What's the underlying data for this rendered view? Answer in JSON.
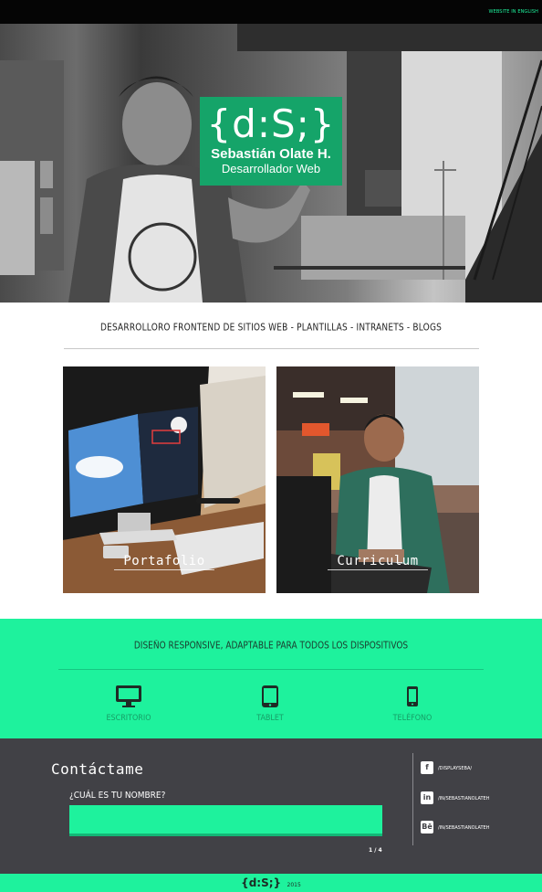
{
  "header": {
    "language_link": "WEBSITE IN ENGLISH"
  },
  "hero": {
    "logo_mark": "{d:S;}",
    "name": "Sebastián Olate H.",
    "role": "Desarrollador Web"
  },
  "intro": {
    "tagline": "DESARROLLORO FRONTEND DE SITIOS WEB - PLANTILLAS - INTRANETS - BLOGS"
  },
  "cards": [
    {
      "label": "Portafolio"
    },
    {
      "label": "Curriculum"
    }
  ],
  "responsive": {
    "title": "DISEÑO RESPONSIVE, ADAPTABLE PARA TODOS LOS DISPOSITIVOS",
    "devices": [
      {
        "label": "ESCRITORIO",
        "icon": "desktop-icon"
      },
      {
        "label": "TABLET",
        "icon": "tablet-icon"
      },
      {
        "label": "TELÉFONO",
        "icon": "phone-icon"
      }
    ]
  },
  "contact": {
    "title": "Contáctame",
    "question": "¿CUÁL ES TU NOMBRE?",
    "name_value": "",
    "step": "1 / 4"
  },
  "social": [
    {
      "icon": "facebook-icon",
      "glyph": "f",
      "handle": "/DISPLAYSEBA/"
    },
    {
      "icon": "linkedin-icon",
      "glyph": "in",
      "handle": "/IN/SEBASTIANOLATEH"
    },
    {
      "icon": "behance-icon",
      "glyph": "Bē",
      "handle": "/IN/SEBASTIANOLATEH"
    }
  ],
  "footer": {
    "logo": "{d:S;}",
    "year": "2015"
  },
  "colors": {
    "accent": "#1ef29d",
    "logo_green": "#15a469",
    "contact_bg": "#414146",
    "topbar": "#050505"
  }
}
